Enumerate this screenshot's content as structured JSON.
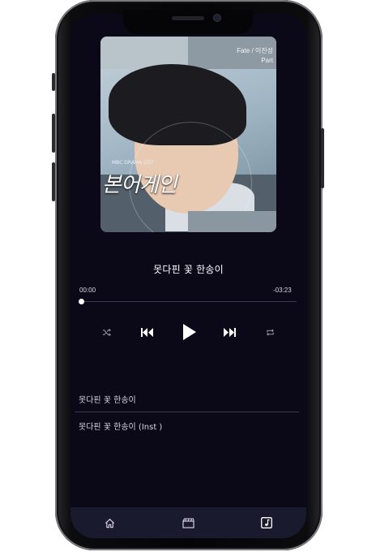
{
  "album": {
    "artist_line": "Fate / 이진성",
    "part_line": "Part",
    "title_art": "본어게인",
    "small_caption": "MBC DRAMA OST"
  },
  "player": {
    "song_title": "못다핀 꽃 한송이",
    "elapsed": "00:00",
    "remaining": "-03:23",
    "progress": 0
  },
  "controls": {
    "shuffle_icon": "shuffle-icon",
    "previous_icon": "previous-icon",
    "play_icon": "play-icon",
    "next_icon": "next-icon",
    "repeat_icon": "repeat-icon"
  },
  "playlist": [
    "못다핀 꽃 한송이",
    "못다핀 꽃 한송이 (Inst )"
  ],
  "nav": {
    "home_icon": "home-icon",
    "video_icon": "clapper-icon",
    "music_icon": "music-note-icon"
  },
  "colors": {
    "screen_bg": "#0b0818",
    "nav_bg": "#1a1a2e",
    "text": "#ffffff"
  }
}
